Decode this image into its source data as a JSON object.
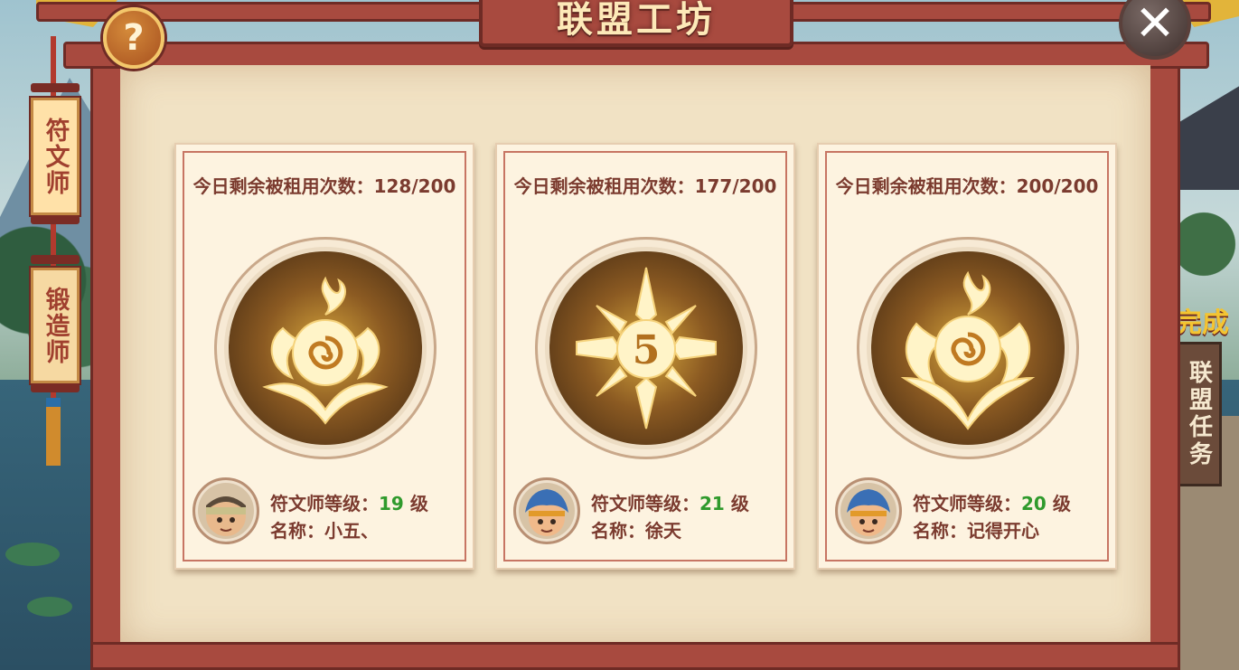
{
  "window": {
    "title": "联盟工坊",
    "help_label": "?",
    "close_label": "✕"
  },
  "tabs": [
    {
      "label": "符文师",
      "active": true
    },
    {
      "label": "锻造师",
      "active": false
    }
  ],
  "side": {
    "done_text": "完成",
    "task_label": "联盟任务"
  },
  "cards": [
    {
      "rent_label": "今日剩余被租用次数：",
      "rent_value": "128/200",
      "emblem": "flame-spiral-rune-icon",
      "level_label": "符文师等级：",
      "level_value": "19",
      "level_unit": "级",
      "name_label": "名称：",
      "name_value": "小五、",
      "avatar": "bandana-hero-avatar"
    },
    {
      "rent_label": "今日剩余被租用次数：",
      "rent_value": "177/200",
      "emblem": "number-five-crest-icon",
      "level_label": "符文师等级：",
      "level_value": "21",
      "level_unit": "级",
      "name_label": "名称：",
      "name_value": "徐天",
      "avatar": "blue-hair-hero-avatar"
    },
    {
      "rent_label": "今日剩余被租用次数：",
      "rent_value": "200/200",
      "emblem": "flame-spiral-rune-icon",
      "level_label": "符文师等级：",
      "level_value": "20",
      "level_unit": "级",
      "name_label": "名称：",
      "name_value": "记得开心",
      "avatar": "blue-hair-hero-avatar"
    }
  ],
  "colors": {
    "frame": "#a84a3f",
    "panel": "#f1e2c4",
    "text": "#7b3b2f",
    "level": "#2f9a2c",
    "gold": "#e2b43a"
  }
}
